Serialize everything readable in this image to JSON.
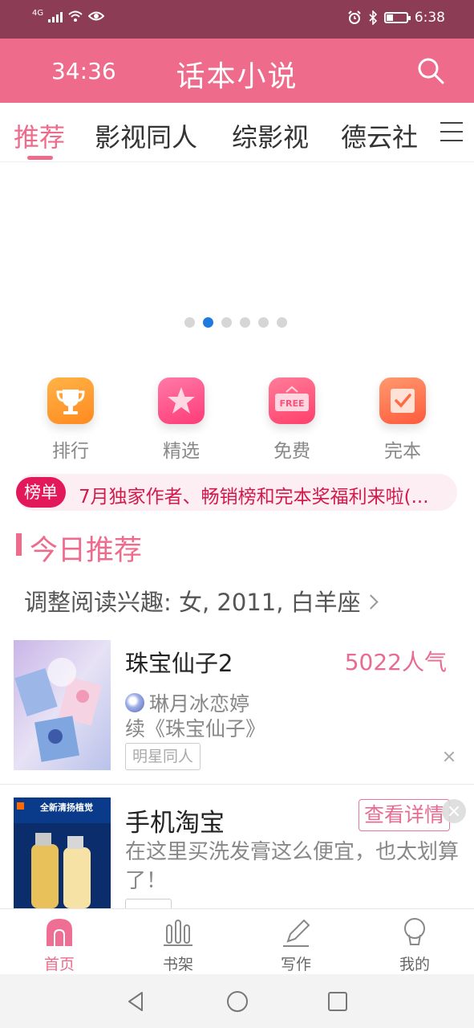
{
  "status_bar": {
    "network": "4G",
    "time": "6:38"
  },
  "header": {
    "timer": "34:36",
    "title": "话本小说",
    "search_icon": "search-icon"
  },
  "tabs": [
    {
      "label": "推荐",
      "active": true
    },
    {
      "label": "影视同人",
      "active": false
    },
    {
      "label": "综影视",
      "active": false
    },
    {
      "label": "德云社",
      "active": false
    }
  ],
  "banner": {
    "page_count": 6,
    "active_index": 1
  },
  "quick_menu": [
    {
      "label": "排行",
      "icon": "trophy-icon"
    },
    {
      "label": "精选",
      "icon": "star-icon"
    },
    {
      "label": "免费",
      "icon": "free-tag-icon",
      "badge": "FREE"
    },
    {
      "label": "完本",
      "icon": "completed-check-icon"
    }
  ],
  "notice": {
    "tag": "榜单",
    "text": "7月独家作者、畅销榜和完本奖福利来啦(..."
  },
  "section": {
    "title": "今日推荐",
    "preference": "调整阅读兴趣: 女, 2011, 白羊座"
  },
  "books": [
    {
      "title": "珠宝仙子2",
      "popularity": "5022人气",
      "author": "琳月冰恋婷",
      "description": "续《珠宝仙子》",
      "tag": "明星同人"
    }
  ],
  "ad": {
    "title": "手机淘宝",
    "description": "在这里买洗发膏这么便宜，也太划算了！",
    "button": "查看详情",
    "cover_text": "全新清扬植觉"
  },
  "bottom_nav": [
    {
      "label": "首页",
      "icon": "home-icon",
      "active": true
    },
    {
      "label": "书架",
      "icon": "bookshelf-icon",
      "active": false
    },
    {
      "label": "写作",
      "icon": "pen-icon",
      "active": false
    },
    {
      "label": "我的",
      "icon": "profile-icon",
      "active": false
    }
  ],
  "colors": {
    "accent": "#ee6b8b",
    "status_bar": "#8c3d55",
    "notice_tag": "#e3185b"
  }
}
